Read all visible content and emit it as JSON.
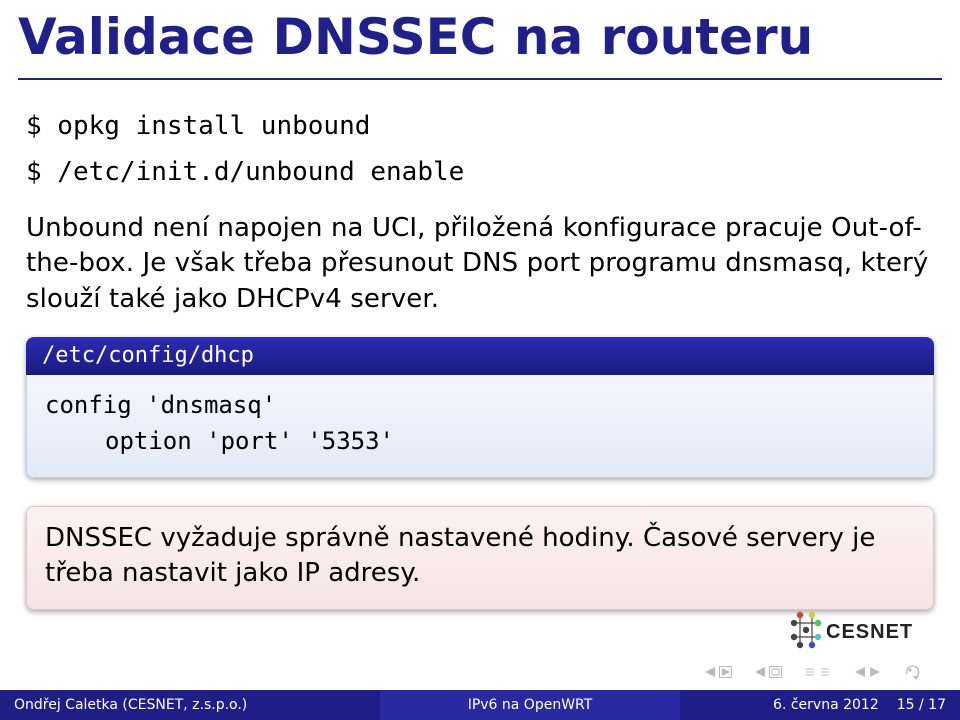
{
  "title": "Validace DNSSEC na routeru",
  "cmds": {
    "l1": "$ opkg install unbound",
    "l2": "$ /etc/init.d/unbound enable"
  },
  "para1": "Unbound není napojen na UCI, přiložená konfigurace pracuje Out-of-the-box. Je však třeba přesunout DNS port programu dnsmasq, který slouží také jako DHCPv4 server.",
  "codebox": {
    "head": "/etc/config/dhcp",
    "line1": "config 'dnsmasq'",
    "line2": "option 'port' '5353'"
  },
  "alert": "DNSSEC vyžaduje správně nastavené hodiny. Časové servery je třeba nastavit jako IP adresy.",
  "logo_text": "CESNET",
  "footer": {
    "left": "Ondřej Caletka (CESNET, z.s.p.o.)",
    "mid": "IPv6 na OpenWRT",
    "date": "6. června 2012",
    "page": "15 / 17"
  }
}
